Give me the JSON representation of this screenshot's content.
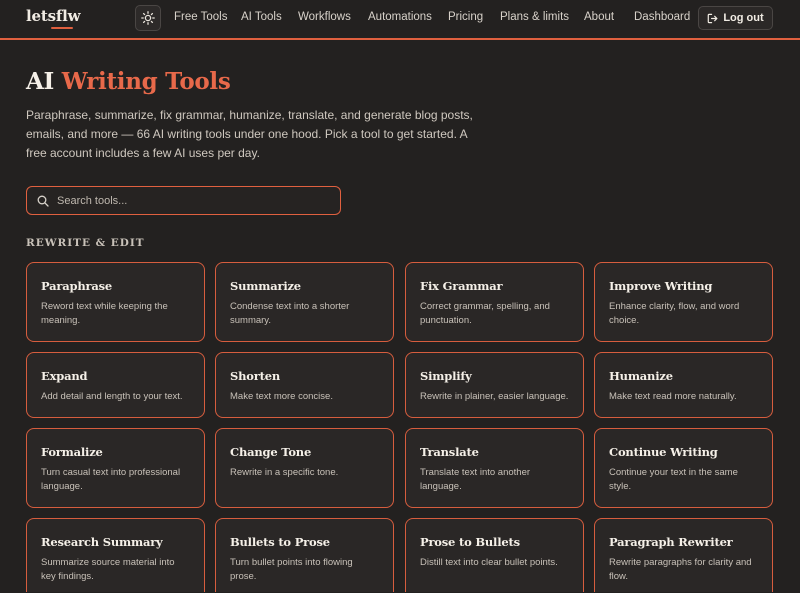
{
  "header": {
    "logo": "letsflw",
    "theme_icon": "sun-icon",
    "nav": [
      "Free Tools",
      "AI Tools",
      "Workflows",
      "Automations",
      "Pricing",
      "Plans & limits",
      "About",
      "Dashboard"
    ],
    "logout_label": "Log out",
    "logout_icon": "logout-icon"
  },
  "hero": {
    "title_plain": "AI",
    "title_accent": "Writing Tools",
    "intro": "Paraphrase, summarize, fix grammar, humanize, translate, and generate blog posts, emails, and more — 66 AI writing tools under one hood. Pick a tool to get started. A free account includes a few AI uses per day."
  },
  "search": {
    "placeholder": "Search tools...",
    "icon": "search-icon"
  },
  "section": {
    "heading": "REWRITE & EDIT",
    "tools": [
      {
        "title": "Paraphrase",
        "desc": "Reword text while keeping the meaning."
      },
      {
        "title": "Summarize",
        "desc": "Condense text into a shorter summary."
      },
      {
        "title": "Fix Grammar",
        "desc": "Correct grammar, spelling, and punctuation."
      },
      {
        "title": "Improve Writing",
        "desc": "Enhance clarity, flow, and word choice."
      },
      {
        "title": "Expand",
        "desc": "Add detail and length to your text."
      },
      {
        "title": "Shorten",
        "desc": "Make text more concise."
      },
      {
        "title": "Simplify",
        "desc": "Rewrite in plainer, easier language."
      },
      {
        "title": "Humanize",
        "desc": "Make text read more naturally."
      },
      {
        "title": "Formalize",
        "desc": "Turn casual text into professional language."
      },
      {
        "title": "Change Tone",
        "desc": "Rewrite in a specific tone."
      },
      {
        "title": "Translate",
        "desc": "Translate text into another language."
      },
      {
        "title": "Continue Writing",
        "desc": "Continue your text in the same style."
      },
      {
        "title": "Research Summary",
        "desc": "Summarize source material into key findings."
      },
      {
        "title": "Bullets to Prose",
        "desc": "Turn bullet points into flowing prose."
      },
      {
        "title": "Prose to Bullets",
        "desc": "Distill text into clear bullet points."
      },
      {
        "title": "Paragraph Rewriter",
        "desc": "Rewrite paragraphs for clarity and flow."
      }
    ]
  },
  "colors": {
    "accent": "#e0603f",
    "background": "#232120",
    "card_bg": "#2a2726"
  }
}
